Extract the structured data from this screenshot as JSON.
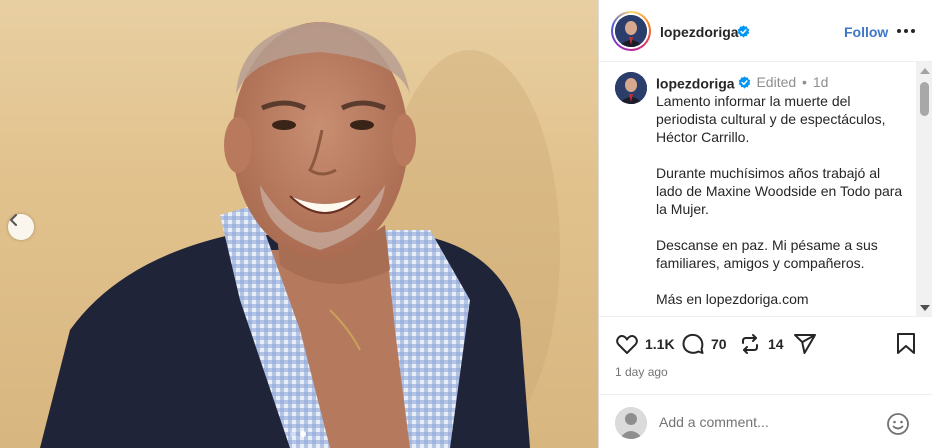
{
  "post": {
    "username": "lopezdoriga",
    "follow_label": "Follow",
    "edited_label": "Edited",
    "separator": "•",
    "age": "1d",
    "caption": [
      "Lamento informar la muerte del periodista cultural y de espectáculos, Héctor Carrillo.",
      "Durante muchísimos años trabajó al lado de Maxine Woodside en Todo para la Mujer.",
      "Descanse en paz. Mi pésame a sus familiares, amigos y compañeros.",
      "Más en lopezdoriga.com"
    ],
    "likes": "1.1K",
    "comments": "70",
    "reposts": "14",
    "posted_time": "1 day ago"
  },
  "comment_box": {
    "placeholder": "Add a comment..."
  },
  "carousel": {
    "total_slides": 2,
    "current_slide": 2
  },
  "colors": {
    "link_blue": "#3f77c7",
    "verified_blue": "#0095f6",
    "text": "#262626",
    "muted": "#737373"
  },
  "icons": [
    "chevron-left-icon",
    "more-icon",
    "verified-icon",
    "heart-icon",
    "comment-icon",
    "repost-icon",
    "share-icon",
    "bookmark-icon",
    "emoji-icon"
  ]
}
